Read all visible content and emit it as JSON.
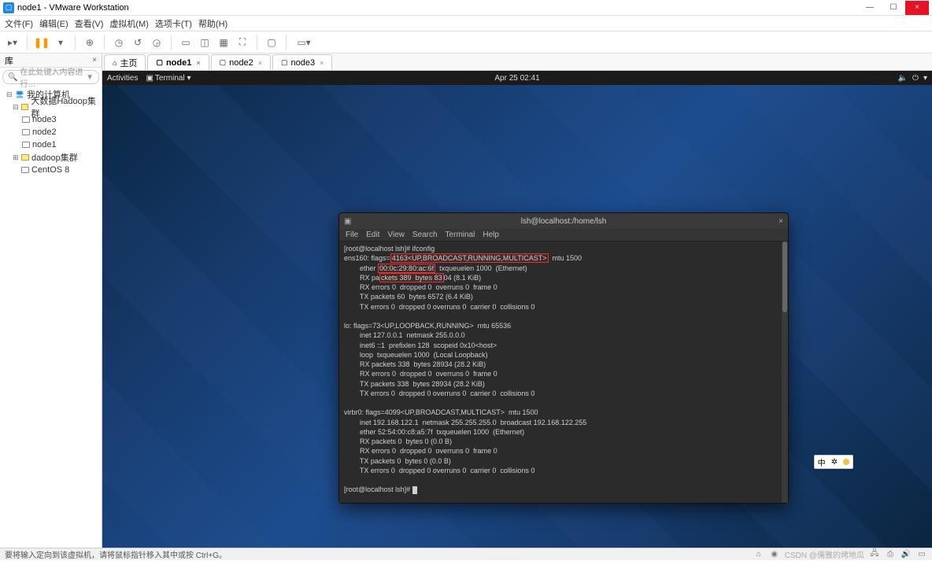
{
  "window": {
    "title": "node1 - VMware Workstation",
    "minimize": "—",
    "maximize": "☐",
    "close": "×"
  },
  "menu": {
    "items": [
      "文件(F)",
      "编辑(E)",
      "查看(V)",
      "虚拟机(M)",
      "选项卡(T)",
      "帮助(H)"
    ]
  },
  "sidebar": {
    "header": "库",
    "close": "×",
    "search_icon": "🔍",
    "search_placeholder": "在此处键入内容进行…",
    "dropdown": "▼",
    "root": {
      "toggle": "⊟",
      "label": "我的计算机"
    },
    "group1": {
      "toggle": "⊟",
      "label": "大数据Hadoop集群"
    },
    "n3": "node3",
    "n2": "node2",
    "n1": "node1",
    "group2": {
      "toggle": "⊞",
      "label": "dadoop集群"
    },
    "centos": "CentOS 8"
  },
  "tabs": {
    "home": {
      "icon": "⌂",
      "label": "主页"
    },
    "t1": {
      "label": "node1",
      "x": "×"
    },
    "t2": {
      "label": "node2",
      "x": "×"
    },
    "t3": {
      "label": "node3",
      "x": "×"
    }
  },
  "gnome": {
    "activities": "Activities",
    "terminal": "Terminal ▾",
    "clock": "Apr 25  02:41",
    "vol": "🔈",
    "power": "⏻",
    "caret": "▾"
  },
  "term": {
    "title": "lsh@localhost:/home/lsh",
    "menus": [
      "File",
      "Edit",
      "View",
      "Search",
      "Terminal",
      "Help"
    ],
    "prompt1": "[root@localhost lsh]# ifconfig",
    "ens_l1a": "ens160: flags=",
    "ens_l1_hl": "4163<UP,BROADCAST,RUNNING,MULTICAST>",
    "ens_l1b": "  mtu 1500",
    "ens_l2a": "        ether ",
    "ens_l2_hl": "00:0c:29:80:ac:6f",
    "ens_l2b": "  txqueuelen 1000  (Ethernet)",
    "ens_l3a": "        RX pa",
    "ens_l3_hl": "ckets 389  bytes 83",
    "ens_l3b": "04 (8.1 KiB)",
    "ens_l4": "        RX errors 0  dropped 0  overruns 0  frame 0",
    "ens_l5": "        TX packets 60  bytes 6572 (6.4 KiB)",
    "ens_l6": "        TX errors 0  dropped 0 overruns 0  carrier 0  collisions 0",
    "blank": "",
    "lo_l1": "lo: flags=73<UP,LOOPBACK,RUNNING>  mtu 65536",
    "lo_l2": "        inet 127.0.0.1  netmask 255.0.0.0",
    "lo_l3": "        inet6 ::1  prefixlen 128  scopeid 0x10<host>",
    "lo_l4": "        loop  txqueuelen 1000  (Local Loopback)",
    "lo_l5": "        RX packets 338  bytes 28934 (28.2 KiB)",
    "lo_l6": "        RX errors 0  dropped 0  overruns 0  frame 0",
    "lo_l7": "        TX packets 338  bytes 28934 (28.2 KiB)",
    "lo_l8": "        TX errors 0  dropped 0 overruns 0  carrier 0  collisions 0",
    "vb_l1": "virbr0: flags=4099<UP,BROADCAST,MULTICAST>  mtu 1500",
    "vb_l2": "        inet 192.168.122.1  netmask 255.255.255.0  broadcast 192.168.122.255",
    "vb_l3": "        ether 52:54:00:c8:a5:7f  txqueuelen 1000  (Ethernet)",
    "vb_l4": "        RX packets 0  bytes 0 (0.0 B)",
    "vb_l5": "        RX errors 0  dropped 0  overruns 0  frame 0",
    "vb_l6": "        TX packets 0  bytes 0 (0.0 B)",
    "vb_l7": "        TX errors 0  dropped 0 overruns 0  carrier 0  collisions 0",
    "prompt2": "[root@localhost lsh]# "
  },
  "ime": {
    "zh": "中",
    "sym": "✲"
  },
  "status": {
    "text": "要将输入定向到该虚拟机，请将鼠标指针移入其中或按 Ctrl+G。",
    "watermark": "CSDN @儒雅的烤地瓜"
  }
}
